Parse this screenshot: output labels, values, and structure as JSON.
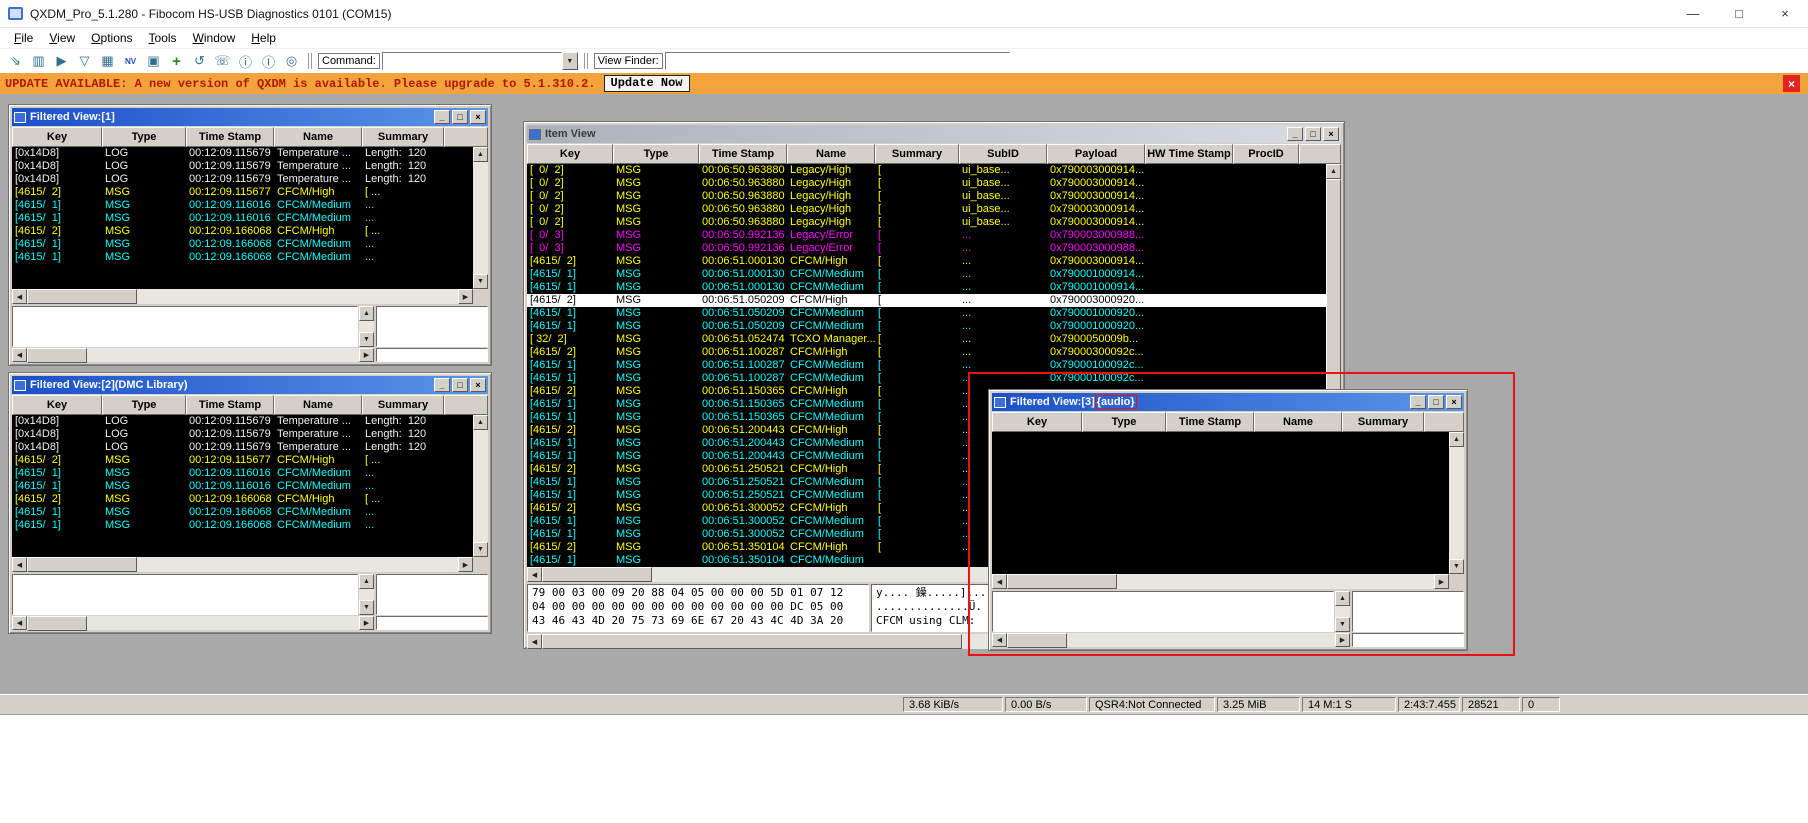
{
  "colors": {
    "row_log": "#f0f0f0",
    "row_high": "#ffff00",
    "row_medium": "#00ffff",
    "row_error": "#ff00ff",
    "selected_bg": "#ffffff",
    "selected_fg": "#000000",
    "banner_bg": "#f2a33c",
    "banner_text": "#b01800",
    "annotation": "#ee1111",
    "title_active_1": "#1c50c8",
    "title_active_2": "#5a96e8",
    "table_bg": "#000000"
  },
  "chrome": {
    "app_minimize": "—",
    "app_maximize": "□",
    "app_close": "×",
    "child_minimize": "_",
    "child_maximize": "□",
    "child_close": "×",
    "scroll_up": "▲",
    "scroll_down": "▼",
    "scroll_left": "◀",
    "scroll_right": "▶"
  },
  "app": {
    "title": "QXDM_Pro_5.1.280 - Fibocom HS-USB Diagnostics 0101 (COM15)",
    "menu": [
      "File",
      "View",
      "Options",
      "Tools",
      "Window",
      "Help"
    ],
    "toolbar": {
      "icons": [
        {
          "name": "connect",
          "glyph": "⇘"
        },
        {
          "name": "open-log",
          "glyph": "▥"
        },
        {
          "name": "start",
          "glyph": "▶"
        },
        {
          "name": "filter",
          "glyph": "▽"
        },
        {
          "name": "item-grid",
          "glyph": "▦"
        },
        {
          "name": "nv-browser",
          "glyph": "NV"
        },
        {
          "name": "save",
          "glyph": "▣"
        },
        {
          "name": "add-view",
          "glyph": "+"
        },
        {
          "name": "refresh",
          "glyph": "↺"
        },
        {
          "name": "phone",
          "glyph": "☏"
        },
        {
          "name": "info",
          "glyph": "ⓘ"
        },
        {
          "name": "item-info",
          "glyph": "Ⓘ"
        },
        {
          "name": "power",
          "glyph": "◎"
        }
      ],
      "command_label": "Command:",
      "command_value": "",
      "view_finder_label": "View Finder:",
      "view_finder_value": ""
    },
    "update_banner": {
      "message": "UPDATE AVAILABLE: A new version of QXDM is available. Please upgrade to 5.1.310.2.",
      "button": "Update Now",
      "close": "×"
    }
  },
  "windows": {
    "filtered1": {
      "title": "Filtered View:[1]",
      "columns": [
        "Key",
        "Type",
        "Time Stamp",
        "Name",
        "Summary"
      ],
      "rows": [
        {
          "key": "[0x14D8]",
          "type": "LOG",
          "ts": "00:12:09.115679",
          "name": "Temperature ...",
          "summary": "Length:  120",
          "cls": "log"
        },
        {
          "key": "[0x14D8]",
          "type": "LOG",
          "ts": "00:12:09.115679",
          "name": "Temperature ...",
          "summary": "Length:  120",
          "cls": "log"
        },
        {
          "key": "[0x14D8]",
          "type": "LOG",
          "ts": "00:12:09.115679",
          "name": "Temperature ...",
          "summary": "Length:  120",
          "cls": "log"
        },
        {
          "key": "[4615/  2]",
          "type": "MSG",
          "ts": "00:12:09.115677",
          "name": "CFCM/High",
          "summary": "[ ...",
          "cls": "high"
        },
        {
          "key": "[4615/  1]",
          "type": "MSG",
          "ts": "00:12:09.116016",
          "name": "CFCM/Medium",
          "summary": "...",
          "cls": "medium"
        },
        {
          "key": "[4615/  1]",
          "type": "MSG",
          "ts": "00:12:09.116016",
          "name": "CFCM/Medium",
          "summary": "...",
          "cls": "medium"
        },
        {
          "key": "[4615/  2]",
          "type": "MSG",
          "ts": "00:12:09.166068",
          "name": "CFCM/High",
          "summary": "[ ...",
          "cls": "high"
        },
        {
          "key": "[4615/  1]",
          "type": "MSG",
          "ts": "00:12:09.166068",
          "name": "CFCM/Medium",
          "summary": "...",
          "cls": "medium"
        },
        {
          "key": "[4615/  1]",
          "type": "MSG",
          "ts": "00:12:09.166068",
          "name": "CFCM/Medium",
          "summary": "...",
          "cls": "medium"
        }
      ]
    },
    "filtered2": {
      "title": "Filtered View:[2](DMC Library)",
      "columns": [
        "Key",
        "Type",
        "Time Stamp",
        "Name",
        "Summary"
      ],
      "rows": [
        {
          "key": "[0x14D8]",
          "type": "LOG",
          "ts": "00:12:09.115679",
          "name": "Temperature ...",
          "summary": "Length:  120",
          "cls": "log"
        },
        {
          "key": "[0x14D8]",
          "type": "LOG",
          "ts": "00:12:09.115679",
          "name": "Temperature ...",
          "summary": "Length:  120",
          "cls": "log"
        },
        {
          "key": "[0x14D8]",
          "type": "LOG",
          "ts": "00:12:09.115679",
          "name": "Temperature ...",
          "summary": "Length:  120",
          "cls": "log"
        },
        {
          "key": "[4615/  2]",
          "type": "MSG",
          "ts": "00:12:09.115677",
          "name": "CFCM/High",
          "summary": "[ ...",
          "cls": "high"
        },
        {
          "key": "[4615/  1]",
          "type": "MSG",
          "ts": "00:12:09.116016",
          "name": "CFCM/Medium",
          "summary": "...",
          "cls": "medium"
        },
        {
          "key": "[4615/  1]",
          "type": "MSG",
          "ts": "00:12:09.116016",
          "name": "CFCM/Medium",
          "summary": "...",
          "cls": "medium"
        },
        {
          "key": "[4615/  2]",
          "type": "MSG",
          "ts": "00:12:09.166068",
          "name": "CFCM/High",
          "summary": "[ ...",
          "cls": "high"
        },
        {
          "key": "[4615/  1]",
          "type": "MSG",
          "ts": "00:12:09.166068",
          "name": "CFCM/Medium",
          "summary": "...",
          "cls": "medium"
        },
        {
          "key": "[4615/  1]",
          "type": "MSG",
          "ts": "00:12:09.166068",
          "name": "CFCM/Medium",
          "summary": "...",
          "cls": "medium"
        }
      ]
    },
    "item_view": {
      "title": "Item View",
      "columns": [
        "Key",
        "Type",
        "Time Stamp",
        "Name",
        "Summary",
        "SubID",
        "Payload",
        "HW Time Stamp",
        "ProcID"
      ],
      "rows": [
        {
          "key": "[  0/  2]",
          "type": "MSG",
          "ts": "00:06:50.963880",
          "name": "Legacy/High",
          "summary": "[",
          "subid": "ui_base...",
          "payload": "0x790003000914...",
          "cls": "high"
        },
        {
          "key": "[  0/  2]",
          "type": "MSG",
          "ts": "00:06:50.963880",
          "name": "Legacy/High",
          "summary": "[",
          "subid": "ui_base...",
          "payload": "0x790003000914...",
          "cls": "high"
        },
        {
          "key": "[  0/  2]",
          "type": "MSG",
          "ts": "00:06:50.963880",
          "name": "Legacy/High",
          "summary": "[",
          "subid": "ui_base...",
          "payload": "0x790003000914...",
          "cls": "high"
        },
        {
          "key": "[  0/  2]",
          "type": "MSG",
          "ts": "00:06:50.963880",
          "name": "Legacy/High",
          "summary": "[",
          "subid": "ui_base...",
          "payload": "0x790003000914...",
          "cls": "high"
        },
        {
          "key": "[  0/  2]",
          "type": "MSG",
          "ts": "00:06:50.963880",
          "name": "Legacy/High",
          "summary": "[",
          "subid": "ui_base...",
          "payload": "0x790003000914...",
          "cls": "high"
        },
        {
          "key": "[  0/  3]",
          "type": "MSG",
          "ts": "00:06:50.992136",
          "name": "Legacy/Error",
          "summary": "[",
          "subid": "...",
          "payload": "0x790003000988...",
          "cls": "error"
        },
        {
          "key": "[  0/  3]",
          "type": "MSG",
          "ts": "00:06:50.992136",
          "name": "Legacy/Error",
          "summary": "[",
          "subid": "...",
          "payload": "0x790003000988...",
          "cls": "error"
        },
        {
          "key": "[4615/  2]",
          "type": "MSG",
          "ts": "00:06:51.000130",
          "name": "CFCM/High",
          "summary": "[",
          "subid": "...",
          "payload": "0x790003000914...",
          "cls": "high"
        },
        {
          "key": "[4615/  1]",
          "type": "MSG",
          "ts": "00:06:51.000130",
          "name": "CFCM/Medium",
          "summary": "[",
          "subid": "...",
          "payload": "0x790001000914...",
          "cls": "medium"
        },
        {
          "key": "[4615/  1]",
          "type": "MSG",
          "ts": "00:06:51.000130",
          "name": "CFCM/Medium",
          "summary": "[",
          "subid": "...",
          "payload": "0x790001000914...",
          "cls": "medium"
        },
        {
          "key": "[4615/  2]",
          "type": "MSG",
          "ts": "00:06:51.050209",
          "name": "CFCM/High",
          "summary": "[",
          "subid": "...",
          "payload": "0x790003000920...",
          "cls": "selected"
        },
        {
          "key": "[4615/  1]",
          "type": "MSG",
          "ts": "00:06:51.050209",
          "name": "CFCM/Medium",
          "summary": "[",
          "subid": "...",
          "payload": "0x790001000920...",
          "cls": "medium"
        },
        {
          "key": "[4615/  1]",
          "type": "MSG",
          "ts": "00:06:51.050209",
          "name": "CFCM/Medium",
          "summary": "[",
          "subid": "...",
          "payload": "0x790001000920...",
          "cls": "medium"
        },
        {
          "key": "[ 32/  2]",
          "type": "MSG",
          "ts": "00:06:51.052474",
          "name": "TCXO Manager...",
          "summary": "[",
          "subid": "...",
          "payload": "0x7900050009b...",
          "cls": "high"
        },
        {
          "key": "[4615/  2]",
          "type": "MSG",
          "ts": "00:06:51.100287",
          "name": "CFCM/High",
          "summary": "[",
          "subid": "...",
          "payload": "0x79000300092c...",
          "cls": "high"
        },
        {
          "key": "[4615/  1]",
          "type": "MSG",
          "ts": "00:06:51.100287",
          "name": "CFCM/Medium",
          "summary": "[",
          "subid": "...",
          "payload": "0x79000100092c...",
          "cls": "medium"
        },
        {
          "key": "[4615/  1]",
          "type": "MSG",
          "ts": "00:06:51.100287",
          "name": "CFCM/Medium",
          "summary": "[",
          "subid": "...",
          "payload": "0x79000100092c...",
          "cls": "medium"
        },
        {
          "key": "[4615/  2]",
          "type": "MSG",
          "ts": "00:06:51.150365",
          "name": "CFCM/High",
          "summary": "[",
          "subid": "...",
          "payload": "",
          "cls": "high"
        },
        {
          "key": "[4615/  1]",
          "type": "MSG",
          "ts": "00:06:51.150365",
          "name": "CFCM/Medium",
          "summary": "[",
          "subid": "...",
          "payload": "",
          "cls": "medium"
        },
        {
          "key": "[4615/  1]",
          "type": "MSG",
          "ts": "00:06:51.150365",
          "name": "CFCM/Medium",
          "summary": "[",
          "subid": "...",
          "payload": "",
          "cls": "medium"
        },
        {
          "key": "[4615/  2]",
          "type": "MSG",
          "ts": "00:06:51.200443",
          "name": "CFCM/High",
          "summary": "[",
          "subid": "...",
          "payload": "",
          "cls": "high"
        },
        {
          "key": "[4615/  1]",
          "type": "MSG",
          "ts": "00:06:51.200443",
          "name": "CFCM/Medium",
          "summary": "[",
          "subid": "...",
          "payload": "",
          "cls": "medium"
        },
        {
          "key": "[4615/  1]",
          "type": "MSG",
          "ts": "00:06:51.200443",
          "name": "CFCM/Medium",
          "summary": "[",
          "subid": "...",
          "payload": "",
          "cls": "medium"
        },
        {
          "key": "[4615/  2]",
          "type": "MSG",
          "ts": "00:06:51.250521",
          "name": "CFCM/High",
          "summary": "[",
          "subid": "...",
          "payload": "",
          "cls": "high"
        },
        {
          "key": "[4615/  1]",
          "type": "MSG",
          "ts": "00:06:51.250521",
          "name": "CFCM/Medium",
          "summary": "[",
          "subid": "...",
          "payload": "",
          "cls": "medium"
        },
        {
          "key": "[4615/  1]",
          "type": "MSG",
          "ts": "00:06:51.250521",
          "name": "CFCM/Medium",
          "summary": "[",
          "subid": "...",
          "payload": "",
          "cls": "medium"
        },
        {
          "key": "[4615/  2]",
          "type": "MSG",
          "ts": "00:06:51.300052",
          "name": "CFCM/High",
          "summary": "[",
          "subid": "...",
          "payload": "",
          "cls": "high"
        },
        {
          "key": "[4615/  1]",
          "type": "MSG",
          "ts": "00:06:51.300052",
          "name": "CFCM/Medium",
          "summary": "[",
          "subid": "...",
          "payload": "",
          "cls": "medium"
        },
        {
          "key": "[4615/  1]",
          "type": "MSG",
          "ts": "00:06:51.300052",
          "name": "CFCM/Medium",
          "summary": "[",
          "subid": "...",
          "payload": "",
          "cls": "medium"
        },
        {
          "key": "[4615/  2]",
          "type": "MSG",
          "ts": "00:06:51.350104",
          "name": "CFCM/High",
          "summary": "[",
          "subid": "...",
          "payload": "",
          "cls": "high"
        },
        {
          "key": "[4615/  1]",
          "type": "MSG",
          "ts": "00:06:51.350104",
          "name": "CFCM/Medium",
          "summary": "",
          "subid": "",
          "payload": "",
          "cls": "medium"
        }
      ],
      "hex": {
        "hex_lines": [
          "79 00 03 00 09 20 88 04 05 00 00 00 5D 01 07 12",
          "04 00 00 00 00 00 00 00 00 00 00 00 00 DC 05 00",
          "43 46 43 4D 20 75 73 69 6E 67 20 43 4C 4D 3A 20"
        ],
        "ascii_lines": [
          "y.... 鐰.....]...",
          "..............Ü.",
          "CFCM using CLM: "
        ]
      }
    },
    "filtered3": {
      "title_prefix": "Filtered View:[3]",
      "title_highlight": "{audio}",
      "columns": [
        "Key",
        "Type",
        "Time Stamp",
        "Name",
        "Summary"
      ],
      "rows": []
    }
  },
  "statusbar": {
    "segments": [
      "3.68 KiB/s",
      "0.00 B/s",
      "QSR4:Not Connected",
      "3.25 MiB",
      "14 M:1 S",
      "2:43:7.455",
      "28521",
      "0"
    ]
  }
}
